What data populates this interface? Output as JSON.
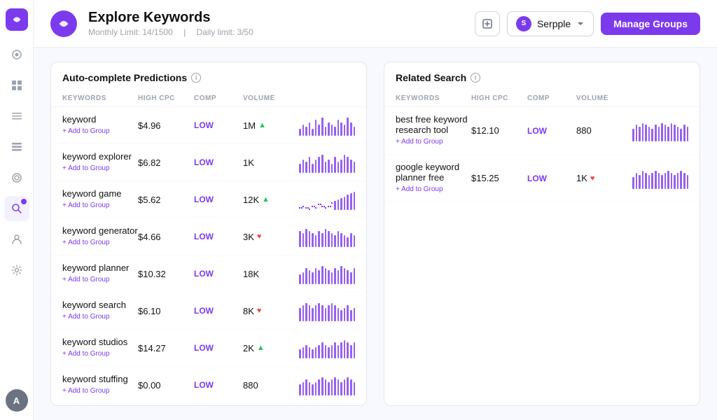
{
  "app": {
    "logo_letter": "S",
    "avatar_letter": "A"
  },
  "header": {
    "logo_letter": "S",
    "title": "Explore Keywords",
    "monthly_limit_label": "Monthly Limit: 14/1500",
    "daily_limit_label": "Daily limit: 3/50",
    "workspace_name": "Serpple",
    "manage_groups_label": "Manage Groups",
    "export_icon": "export"
  },
  "sidebar": {
    "items": [
      {
        "icon": "◉",
        "name": "home",
        "active": false
      },
      {
        "icon": "⊞",
        "name": "dashboard",
        "active": false
      },
      {
        "icon": "▤",
        "name": "reports",
        "active": false
      },
      {
        "icon": "☰",
        "name": "lists",
        "active": false
      },
      {
        "icon": "◎",
        "name": "monitor",
        "active": false
      },
      {
        "icon": "🔍",
        "name": "explore",
        "active": true,
        "badge": true
      },
      {
        "icon": "◉",
        "name": "profile",
        "active": false
      },
      {
        "icon": "⚙",
        "name": "settings",
        "active": false
      }
    ]
  },
  "auto_complete": {
    "title": "Auto-complete Predictions",
    "columns": [
      "KEYWORDS",
      "HIGH CPC",
      "COMP",
      "VOLUME",
      ""
    ],
    "rows": [
      {
        "keyword": "keyword",
        "cpc": "$4.96",
        "comp": "LOW",
        "volume": "1M",
        "trend": "up",
        "bars": [
          3,
          5,
          4,
          6,
          3,
          7,
          5,
          8,
          4,
          6,
          5,
          4,
          7,
          6,
          5,
          8,
          6,
          4
        ]
      },
      {
        "keyword": "keyword explorer",
        "cpc": "$6.82",
        "comp": "LOW",
        "volume": "1K",
        "trend": "none",
        "bars": [
          4,
          6,
          5,
          7,
          4,
          6,
          7,
          8,
          5,
          6,
          4,
          7,
          5,
          6,
          8,
          7,
          6,
          5
        ]
      },
      {
        "keyword": "keyword game",
        "cpc": "$5.62",
        "comp": "LOW",
        "volume": "12K",
        "trend": "up",
        "bars": [
          2,
          3,
          2,
          1,
          3,
          2,
          4,
          3,
          2,
          3,
          5,
          6,
          7,
          8,
          9,
          10,
          11,
          12
        ],
        "dotted": true
      },
      {
        "keyword": "keyword generator",
        "cpc": "$4.66",
        "comp": "LOW",
        "volume": "3K",
        "trend": "down",
        "bars": [
          8,
          7,
          9,
          8,
          7,
          6,
          8,
          7,
          9,
          8,
          7,
          6,
          8,
          7,
          6,
          5,
          7,
          6
        ]
      },
      {
        "keyword": "keyword planner",
        "cpc": "$10.32",
        "comp": "LOW",
        "volume": "18K",
        "trend": "none",
        "bars": [
          5,
          6,
          8,
          7,
          6,
          8,
          7,
          9,
          8,
          7,
          6,
          8,
          7,
          9,
          8,
          7,
          6,
          8
        ]
      },
      {
        "keyword": "keyword search",
        "cpc": "$6.10",
        "comp": "LOW",
        "volume": "8K",
        "trend": "down",
        "bars": [
          6,
          7,
          8,
          7,
          6,
          7,
          8,
          7,
          6,
          7,
          8,
          7,
          6,
          5,
          6,
          7,
          5,
          6
        ]
      },
      {
        "keyword": "keyword studios",
        "cpc": "$14.27",
        "comp": "LOW",
        "volume": "2K",
        "trend": "up",
        "bars": [
          4,
          5,
          6,
          5,
          4,
          5,
          6,
          7,
          6,
          5,
          6,
          7,
          6,
          7,
          8,
          7,
          6,
          7
        ]
      },
      {
        "keyword": "keyword stuffing",
        "cpc": "$0.00",
        "comp": "LOW",
        "volume": "880",
        "trend": "none",
        "bars": [
          5,
          6,
          7,
          6,
          5,
          6,
          7,
          8,
          7,
          6,
          7,
          8,
          7,
          6,
          7,
          8,
          7,
          6
        ]
      }
    ]
  },
  "related_search": {
    "title": "Related Search",
    "columns": [
      "KEYWORDS",
      "HIGH CPC",
      "COMP",
      "VOLUME",
      ""
    ],
    "rows": [
      {
        "keyword": "best free keyword research tool",
        "cpc": "$12.10",
        "comp": "LOW",
        "volume": "880",
        "trend": "none",
        "bars": [
          6,
          8,
          7,
          9,
          8,
          7,
          6,
          8,
          7,
          9,
          8,
          7,
          9,
          8,
          7,
          6,
          8,
          7
        ]
      },
      {
        "keyword": "google keyword planner free",
        "cpc": "$15.25",
        "comp": "LOW",
        "volume": "1K",
        "trend": "down",
        "bars": [
          5,
          7,
          6,
          8,
          7,
          6,
          7,
          8,
          7,
          6,
          7,
          8,
          7,
          6,
          7,
          8,
          7,
          6
        ]
      }
    ]
  }
}
